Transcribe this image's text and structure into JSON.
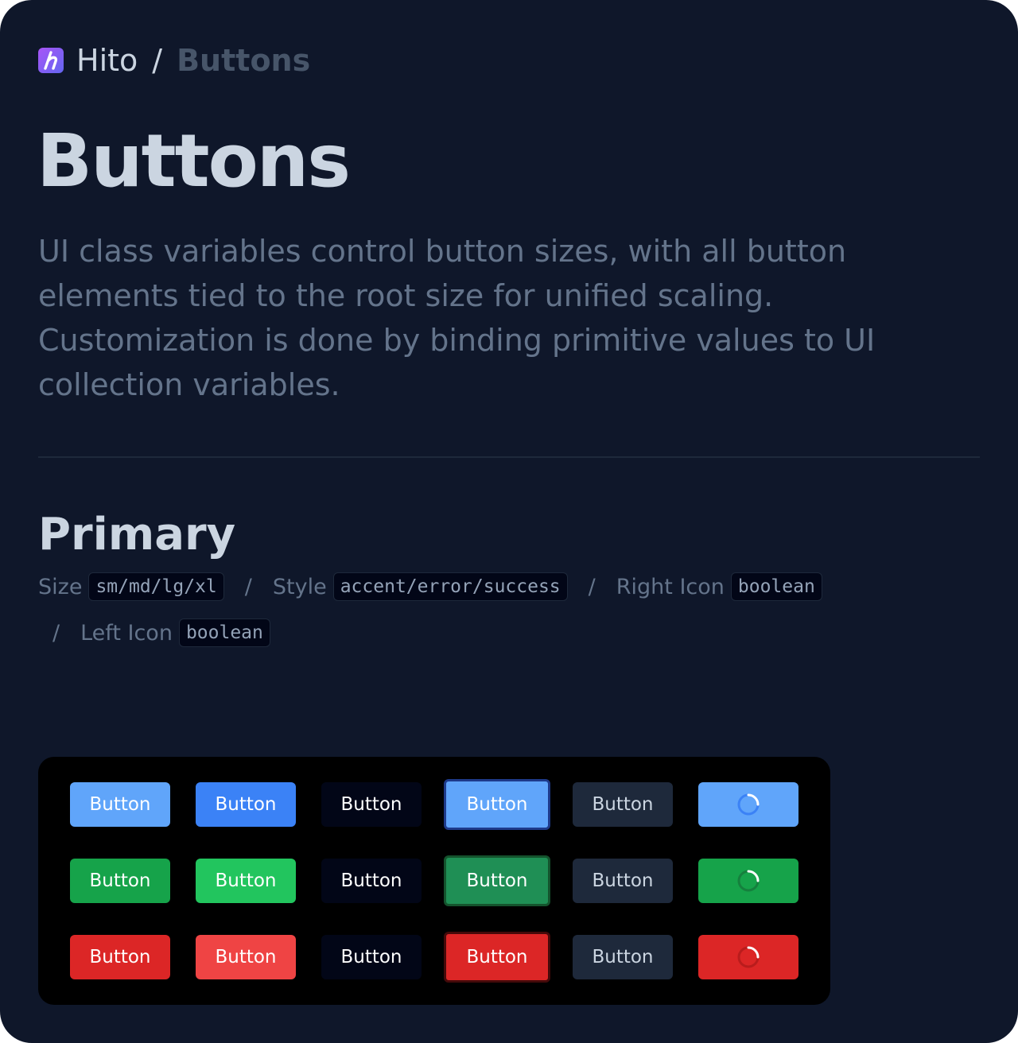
{
  "breadcrumb": {
    "home": "Hito",
    "separator": "/",
    "current": "Buttons"
  },
  "page": {
    "title": "Buttons",
    "description": "UI class variables control button sizes, with all button elements tied to the root size for unified scaling. Customization is done by binding primitive values to UI collection variables."
  },
  "section": {
    "title": "Primary"
  },
  "props": {
    "separator": "/",
    "size_label": "Size",
    "size_value": "sm/md/lg/xl",
    "style_label": "Style",
    "style_value": "accent/error/success",
    "right_icon_label": "Right Icon",
    "right_icon_value": "boolean",
    "left_icon_label": "Left Icon",
    "left_icon_value": "boolean"
  },
  "colors": {
    "background": "#0f172a",
    "accent": "#60a5fa",
    "accent_hover": "#3b82f6",
    "success": "#16a34a",
    "success_hover": "#22c55e",
    "error": "#dc2626",
    "error_hover": "#ef4444",
    "ghost": "#020617",
    "disabled": "#1e293b"
  },
  "button_grid": {
    "rows": [
      {
        "style": "accent",
        "buttons": [
          "Button",
          "Button",
          "Button",
          "Button",
          "Button",
          ""
        ]
      },
      {
        "style": "success",
        "buttons": [
          "Button",
          "Button",
          "Button",
          "Button",
          "Button",
          ""
        ]
      },
      {
        "style": "error",
        "buttons": [
          "Button",
          "Button",
          "Button",
          "Button",
          "Button",
          ""
        ]
      }
    ],
    "states": [
      "default",
      "hover",
      "ghost",
      "focus",
      "disabled",
      "loading"
    ],
    "loading_icon": "spinner-icon"
  }
}
